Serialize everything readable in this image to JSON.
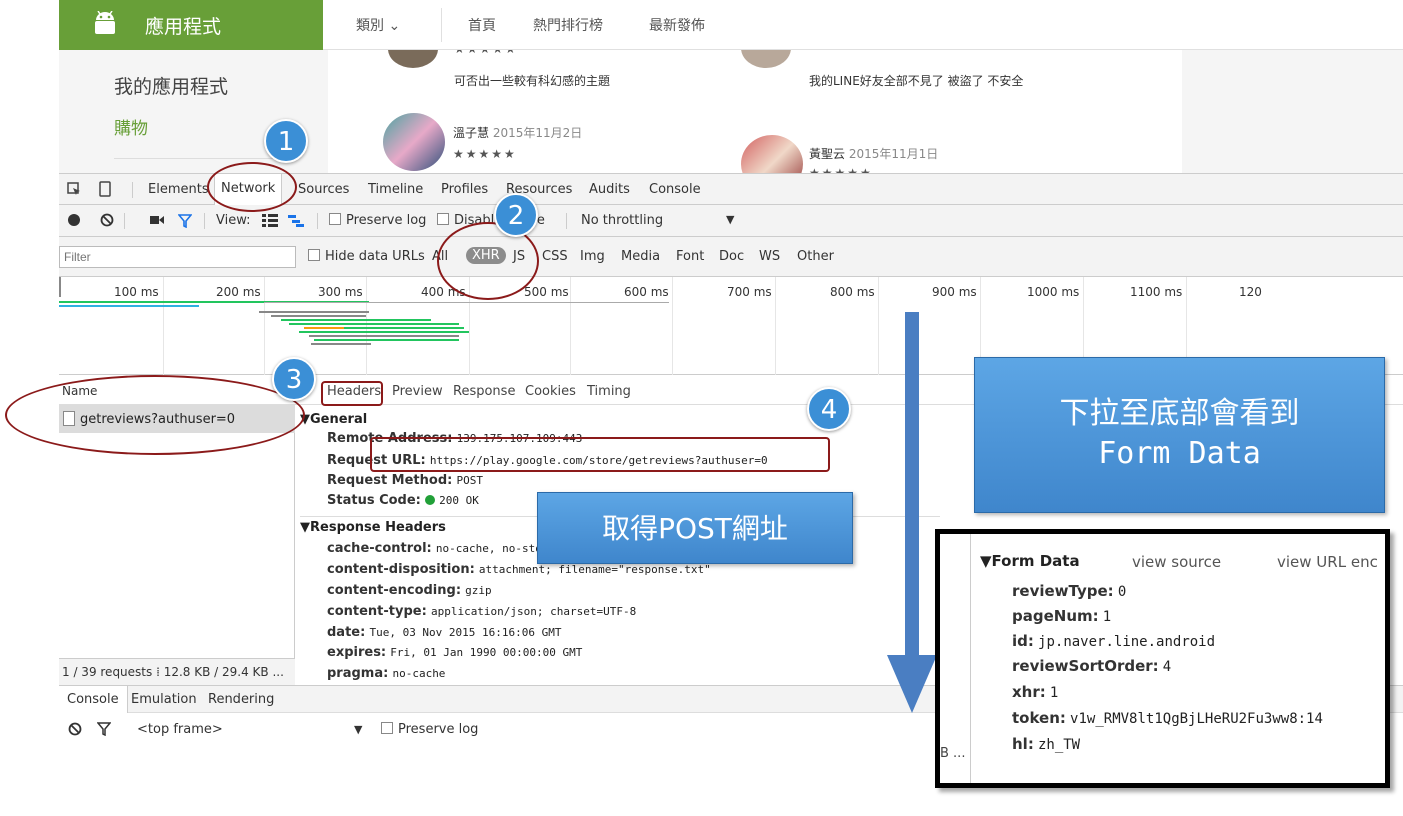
{
  "play": {
    "brand": "應用程式",
    "nav": {
      "category": "類別 ⌄",
      "home": "首頁",
      "charts": "熱門排行榜",
      "new": "最新發佈"
    },
    "sidebar": {
      "my_apps": "我的應用程式",
      "shopping": "購物"
    },
    "reviews": [
      {
        "text": "可否出一些較有科幻感的主題"
      },
      {
        "text": "我的LINE好友全部不見了 被盜了 不安全"
      },
      {
        "author": "溫子慧",
        "date": "2015年11月2日",
        "stars": "★★★★★"
      },
      {
        "author": "黃聖云",
        "date": "2015年11月1日",
        "stars": "★★★★★"
      }
    ]
  },
  "devtools": {
    "tabs": [
      "Elements",
      "Network",
      "Sources",
      "Timeline",
      "Profiles",
      "Resources",
      "Audits",
      "Console"
    ],
    "toolbar": {
      "view_label": "View:",
      "preserve_log": "Preserve log",
      "disable_cache": "Disable cache",
      "throttle": "No throttling"
    },
    "filter": {
      "placeholder": "Filter",
      "hide_data_urls": "Hide data URLs",
      "types": [
        "All",
        "XHR",
        "JS",
        "CSS",
        "Img",
        "Media",
        "Font",
        "Doc",
        "WS",
        "Other"
      ]
    },
    "timeline_ticks": [
      "100 ms",
      "200 ms",
      "300 ms",
      "400 ms",
      "500 ms",
      "600 ms",
      "700 ms",
      "800 ms",
      "900 ms",
      "1000 ms",
      "1100 ms",
      "120"
    ],
    "requests": {
      "header": "Name",
      "items": [
        "getreviews?authuser=0"
      ],
      "summary": "1 / 39 requests ⁞ 12.8 KB / 29.4 KB ..."
    },
    "detail_tabs": [
      "Headers",
      "Preview",
      "Response",
      "Cookies",
      "Timing"
    ],
    "general": {
      "title": "▼General",
      "rows": [
        {
          "k": "Remote Address:",
          "v": "139.175.107.109:443"
        },
        {
          "k": "Request URL:",
          "v": "https://play.google.com/store/getreviews?authuser=0"
        },
        {
          "k": "Request Method:",
          "v": "POST"
        },
        {
          "k": "Status Code:",
          "v": "200 OK"
        }
      ]
    },
    "response_headers": {
      "title": "▼Response Headers",
      "rows": [
        {
          "k": "cache-control:",
          "v": "no-cache, no-store"
        },
        {
          "k": "content-disposition:",
          "v": "attachment; filename=\"response.txt\""
        },
        {
          "k": "content-encoding:",
          "v": "gzip"
        },
        {
          "k": "content-type:",
          "v": "application/json; charset=UTF-8"
        },
        {
          "k": "date:",
          "v": "Tue, 03 Nov 2015 16:16:06 GMT"
        },
        {
          "k": "expires:",
          "v": "Fri, 01 Jan 1990 00:00:00 GMT"
        },
        {
          "k": "pragma:",
          "v": "no-cache"
        }
      ]
    },
    "drawer_tabs": [
      "Console",
      "Emulation",
      "Rendering"
    ],
    "console": {
      "frame": "<top frame>",
      "preserve_log": "Preserve log"
    },
    "status_color": "#21a038"
  },
  "form_data": {
    "title": "▼Form Data",
    "view_source": "view source",
    "view_url": "view URL enc",
    "rows": [
      {
        "k": "reviewType:",
        "v": "0"
      },
      {
        "k": "pageNum:",
        "v": "1"
      },
      {
        "k": "id:",
        "v": "jp.naver.line.android"
      },
      {
        "k": "reviewSortOrder:",
        "v": "4"
      },
      {
        "k": "xhr:",
        "v": "1"
      },
      {
        "k": "token:",
        "v": "v1w_RMV8lt1QgBjLHeRU2Fu3ww8:14"
      },
      {
        "k": "hl:",
        "v": "zh_TW"
      }
    ],
    "clipped": "B ..."
  },
  "annotations": {
    "steps": [
      "1",
      "2",
      "3",
      "4"
    ],
    "callout_post": "取得POST網址",
    "callout_scroll_line1": "下拉至底部會看到",
    "callout_scroll_line2": "Form Data"
  }
}
